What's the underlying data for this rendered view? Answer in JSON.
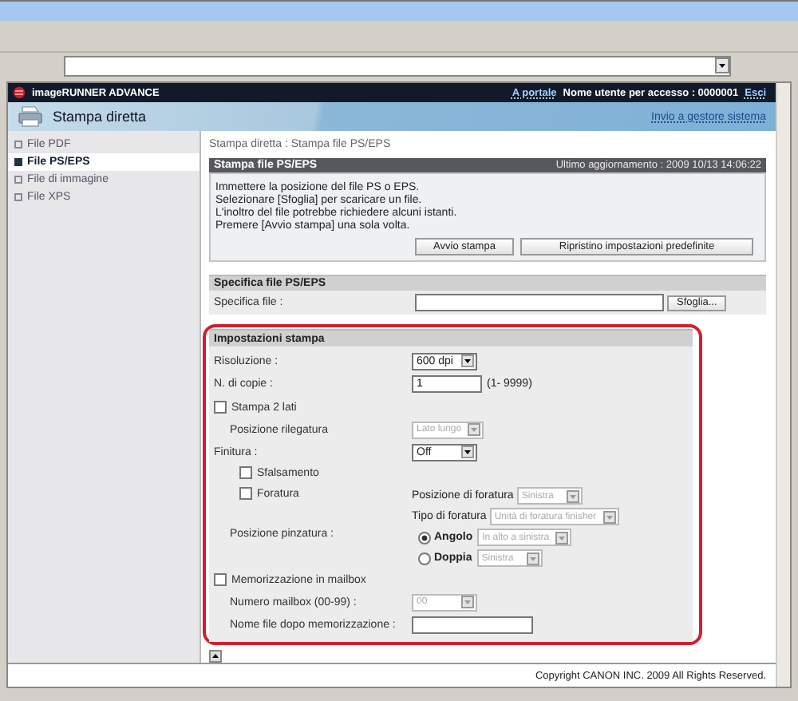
{
  "header": {
    "product": "imageRUNNER ADVANCE",
    "portal_link": "A portale",
    "user_label": "Nome utente per accesso : 0000001",
    "logout_link": "Esci"
  },
  "subheader": {
    "title": "Stampa diretta",
    "system_link": "Invio a gestore sistema"
  },
  "sidebar": {
    "items": [
      {
        "label": "File PDF",
        "selected": false
      },
      {
        "label": "File PS/EPS",
        "selected": true
      },
      {
        "label": "File di immagine",
        "selected": false
      },
      {
        "label": "File XPS",
        "selected": false
      }
    ]
  },
  "breadcrumb": "Stampa diretta : Stampa file PS/EPS",
  "print_panel": {
    "title": "Stampa file PS/EPS",
    "updated": "Ultimo aggiornamento : 2009 10/13 14:06:22",
    "instructions": [
      "Immettere la posizione del file PS o EPS.",
      "Selezionare [Sfoglia] per scaricare un file.",
      "L'inoltro del file potrebbe richiedere alcuni istanti.",
      "Premere [Avvio stampa] una sola volta."
    ],
    "buttons": [
      "Avvio stampa",
      "Ripristino impostazioni predefinite"
    ]
  },
  "file_section": {
    "title": "Specifica file PS/EPS",
    "label": "Specifica file :",
    "browse_button": "Sfoglia..."
  },
  "settings": {
    "title": "Impostazioni stampa",
    "rows": [
      {
        "kind": "select",
        "label": "Risoluzione :",
        "value": "600 dpi",
        "disabled": false
      },
      {
        "kind": "number",
        "label": "N. di copie :",
        "value": "1",
        "hint": "(1- 9999)"
      },
      {
        "kind": "check",
        "label": "Stampa 2 lati",
        "checked": false,
        "children": [
          {
            "kind": "select",
            "label": "Posizione rilegatura",
            "value": "Lato lungo",
            "disabled": true
          }
        ]
      },
      {
        "kind": "select",
        "label": "Finitura :",
        "value": "Off",
        "disabled": false,
        "children": [
          {
            "kind": "check",
            "label": "Sfalsamento",
            "checked": false
          },
          {
            "kind": "check",
            "label": "Foratura",
            "checked": false,
            "options": [
              {
                "label": "Posizione di foratura",
                "value": "Sinistra",
                "disabled": true
              },
              {
                "label": "Tipo di foratura",
                "value": "Unità di foratura finisher",
                "disabled": true
              }
            ]
          },
          {
            "kind": "radio",
            "label": "Posizione pinzatura :",
            "options": [
              {
                "label": "Angolo",
                "selected": true,
                "value": "In alto a sinistra",
                "disabled": true
              },
              {
                "label": "Doppia",
                "selected": false,
                "value": "Sinistra",
                "disabled": true
              }
            ]
          }
        ]
      },
      {
        "kind": "check",
        "label": "Memorizzazione in mailbox",
        "checked": false,
        "children": [
          {
            "kind": "select",
            "label": "Numero mailbox (00-99) :",
            "value": "00",
            "disabled": true
          },
          {
            "kind": "text",
            "label": "Nome file dopo memorizzazione :"
          }
        ]
      }
    ]
  },
  "copyright": "Copyright CANON INC. 2009 All Rights Reserved."
}
